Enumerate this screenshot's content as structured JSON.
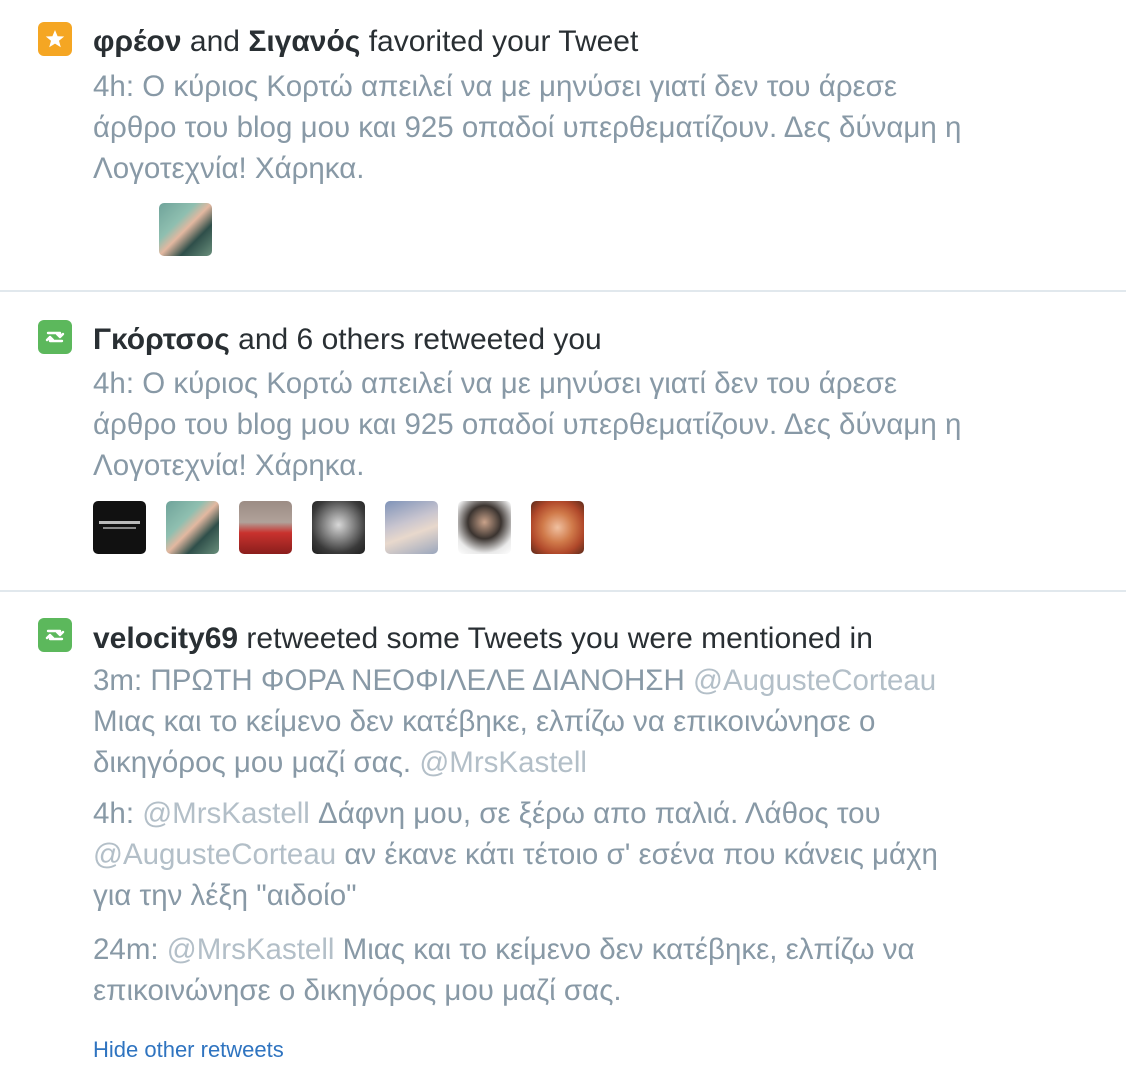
{
  "items": [
    {
      "type": "favorite",
      "icon": "star-icon",
      "user1": "φρέον",
      "and1": " and ",
      "user2": "Σιγανός",
      "action": " favorited your Tweet",
      "tweet": {
        "time": "4h:",
        "line1": " Ο κύριος Κορτώ απειλεί να με μηνύσει γιατί δεν του άρεσε",
        "line2": "άρθρο του blog μου και 925  οπαδοί υπερθεματίζουν. Δες δύναμη η",
        "line3": "Λογοτεχνία! Χάρηκα."
      }
    },
    {
      "type": "retweet",
      "icon": "retweet-icon",
      "user1": "Γκόρτσος",
      "action": " and 6 others retweeted you",
      "tweet": {
        "time": "4h:",
        "line1": " Ο κύριος Κορτώ απειλεί να με μηνύσει γιατί δεν του άρεσε",
        "line2": "άρθρο του blog μου και 925  οπαδοί υπερθεματίζουν. Δες δύναμη η",
        "line3": "Λογοτεχνία! Χάρηκα."
      }
    },
    {
      "type": "retweet",
      "icon": "retweet-icon",
      "user1": "velocity69",
      "action": " retweeted some Tweets you were mentioned in",
      "tweets": [
        {
          "time": "3m:",
          "line1a": " ΠΡΩΤΗ ΦΟΡΑ ΝΕΟΦΙΛΕΛΕ ΔΙΑΝΟΗΣΗ ",
          "mention1": "@AugusteCorteau",
          "line2": "Μιας και το κείμενο δεν κατέβηκε, ελπίζω να επικοινώνησε ο",
          "line3a": "δικηγόρος μου μαζί σας. ",
          "mention2": "@MrsKastell"
        },
        {
          "time": "4h:",
          "mention1": " @MrsKastell",
          "line1b": " Δάφνη μου, σε ξέρω απο παλιά. Λάθος του",
          "mention2": "@AugusteCorteau",
          "line2b": " αν έκανε κάτι τέτοιο σ' εσένα που κάνεις μάχη",
          "line3": "για την λέξη \"αιδοίο\""
        },
        {
          "time": "24m:",
          "mention1": " @MrsKastell",
          "line1b": " Μιας και το κείμενο δεν κατέβηκε, ελπίζω να",
          "line2": "επικοινώνησε ο δικηγόρος μου μαζί σας."
        }
      ],
      "hide_link": "Hide other retweets"
    }
  ]
}
